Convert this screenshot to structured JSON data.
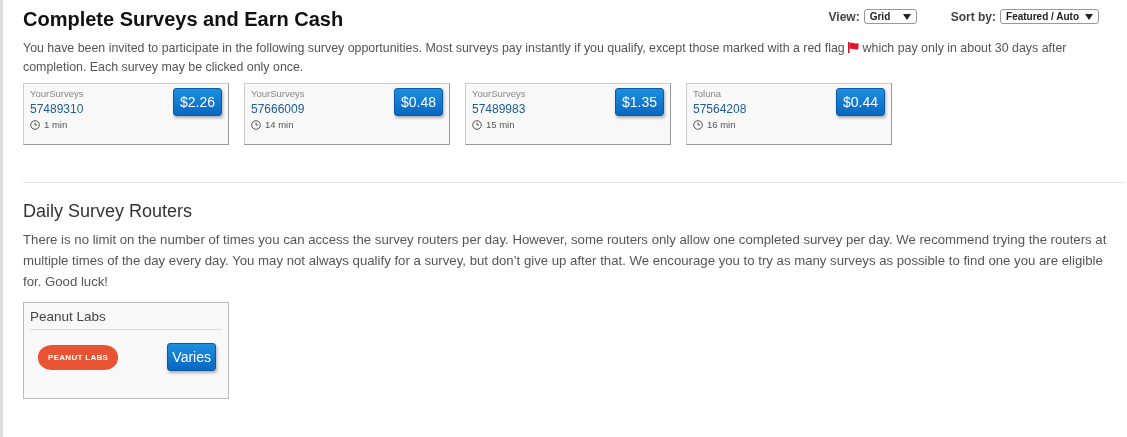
{
  "header": {
    "title": "Complete Surveys and Earn Cash",
    "view": {
      "label": "View:",
      "value": "Grid"
    },
    "sort": {
      "label": "Sort by:",
      "value": "Featured / Auto"
    }
  },
  "intro": {
    "before": "You have been invited to participate in the following survey opportunities. Most surveys pay instantly if you qualify, except those marked with a red flag",
    "after": "which pay only in about 30 days after completion. Each survey may be clicked only once."
  },
  "surveys": [
    {
      "provider": "YourSurveys",
      "id": "57489310",
      "duration": "1 min",
      "price": "$2.26"
    },
    {
      "provider": "YourSurveys",
      "id": "57666009",
      "duration": "14 min",
      "price": "$0.48"
    },
    {
      "provider": "YourSurveys",
      "id": "57489983",
      "duration": "15 min",
      "price": "$1.35"
    },
    {
      "provider": "Toluna",
      "id": "57564208",
      "duration": "16 min",
      "price": "$0.44"
    }
  ],
  "routers": {
    "title": "Daily Survey Routers",
    "text": "There is no limit on the number of times you can access the survey routers per day. However, some routers only allow one completed survey per day. We recommend trying the routers at multiple times of the day every day. You may not always qualify for a survey, but don’t give up after that. We encourage you to try as many surveys as possible to find one you are eligible for. Good luck!",
    "items": [
      {
        "name": "Peanut Labs",
        "logo_text": "PEANUT LABS",
        "price": "Varies"
      }
    ]
  }
}
